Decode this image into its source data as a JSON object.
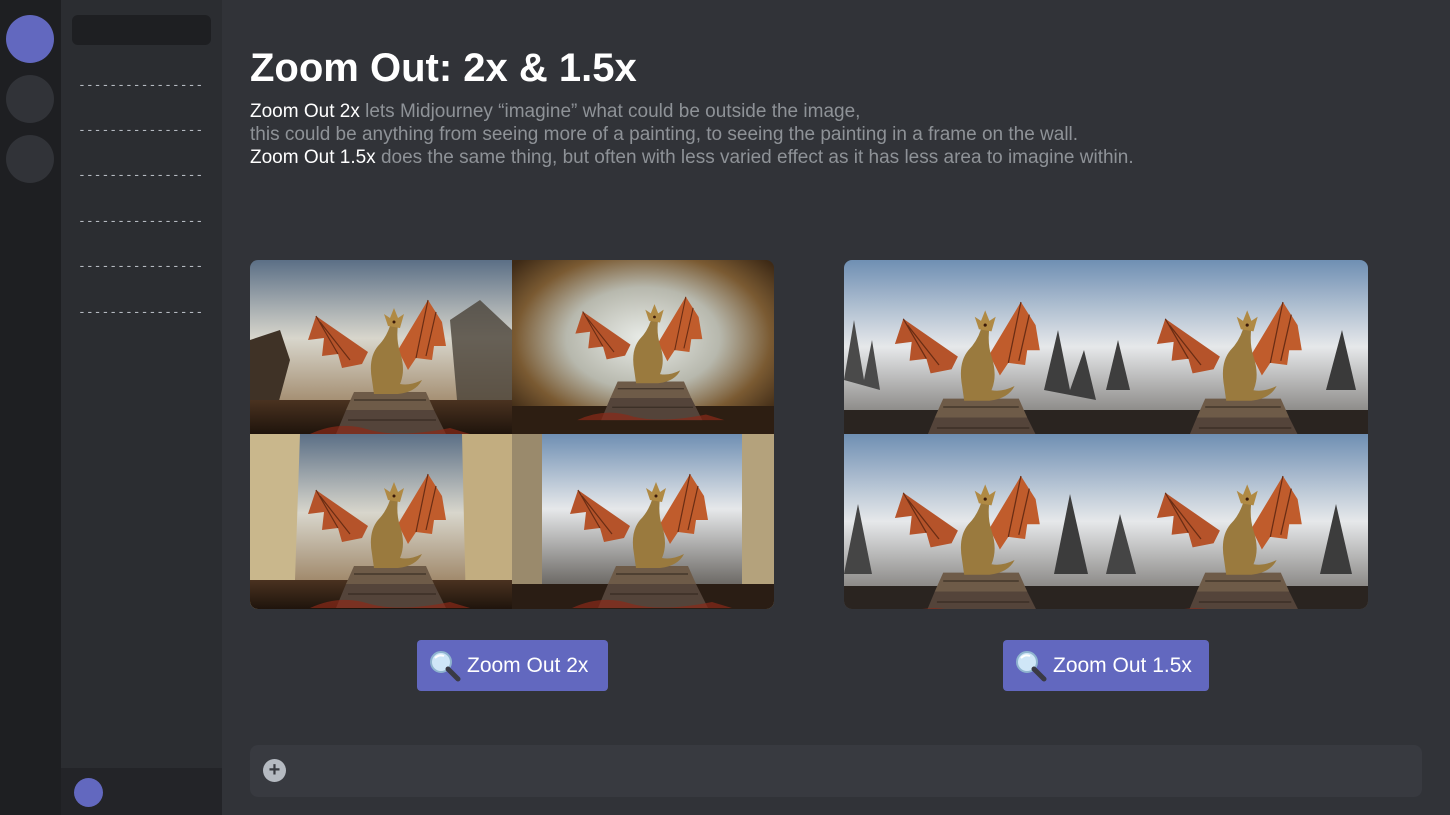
{
  "server_rail": {
    "servers": [
      {
        "name": "server-active",
        "color": "#6268bf"
      },
      {
        "name": "server-2",
        "color": "#313338"
      },
      {
        "name": "server-3",
        "color": "#313338"
      }
    ]
  },
  "sidebar": {
    "channels": [
      {
        "label": "----------------"
      },
      {
        "label": "----------------"
      },
      {
        "label": "----------------"
      },
      {
        "label": "----------------"
      },
      {
        "label": "----------------"
      },
      {
        "label": "----------------"
      }
    ]
  },
  "main": {
    "title": "Zoom Out: 2x & 1.5x",
    "description": {
      "line1_highlight": "Zoom Out 2x",
      "line1_rest": " lets Midjourney “imagine” what could be outside the image,",
      "line2": "this could be anything from seeing more of a painting, to seeing the painting in a frame on the wall.",
      "line3_highlight": "Zoom Out 1.5x",
      "line3_rest": " does the same thing, but often with less varied effect as it has less area to imagine within."
    },
    "grid_2x": {
      "tiles": [
        "dragon-ruins",
        "dragon-framed-painting",
        "dragon-stone-pillars",
        "dragon-framed-wall"
      ]
    },
    "grid_1_5x": {
      "tiles": [
        "dragon-spires-1",
        "dragon-spires-2",
        "dragon-spires-3",
        "dragon-spires-4"
      ]
    },
    "buttons": {
      "zoom_2x_label": "Zoom Out 2x",
      "zoom_1_5x_label": "Zoom Out 1.5x",
      "icon": "magnifying-glass-icon"
    },
    "composer": {
      "plus_icon": "plus-circle-icon",
      "placeholder": ""
    }
  },
  "colors": {
    "accent": "#6268bf",
    "background": "#313338",
    "sidebar": "#2b2d31",
    "rail": "#1e1f22"
  }
}
